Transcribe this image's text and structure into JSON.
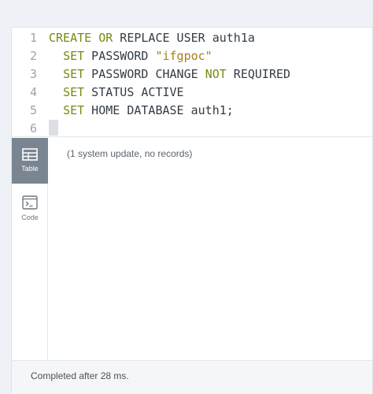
{
  "editor": {
    "lines": [
      {
        "number": "1",
        "parts": [
          {
            "text": "CREATE",
            "cls": "kw"
          },
          {
            "text": " "
          },
          {
            "text": "OR",
            "cls": "kw"
          },
          {
            "text": " REPLACE USER auth1a"
          }
        ]
      },
      {
        "number": "2",
        "parts": [
          {
            "text": "  "
          },
          {
            "text": "SET",
            "cls": "kw"
          },
          {
            "text": " PASSWORD "
          },
          {
            "text": "\"ifgpoc\"",
            "cls": "str"
          }
        ]
      },
      {
        "number": "3",
        "parts": [
          {
            "text": "  "
          },
          {
            "text": "SET",
            "cls": "kw"
          },
          {
            "text": " PASSWORD CHANGE "
          },
          {
            "text": "NOT",
            "cls": "kw"
          },
          {
            "text": " REQUIRED"
          }
        ]
      },
      {
        "number": "4",
        "parts": [
          {
            "text": "  "
          },
          {
            "text": "SET",
            "cls": "kw"
          },
          {
            "text": " STATUS ACTIVE"
          }
        ]
      },
      {
        "number": "5",
        "parts": [
          {
            "text": "  "
          },
          {
            "text": "SET",
            "cls": "kw"
          },
          {
            "text": " HOME DATABASE auth1;"
          }
        ]
      },
      {
        "number": "6",
        "parts": []
      }
    ]
  },
  "sidebar": {
    "items": [
      {
        "label": "Table",
        "icon": "table-icon",
        "active": true
      },
      {
        "label": "Code",
        "icon": "code-icon",
        "active": false
      }
    ]
  },
  "result": {
    "message": "(1 system update, no records)"
  },
  "footer": {
    "status": "Completed after 28 ms."
  },
  "colors": {
    "keyword": "#768a10",
    "string": "#a57f18",
    "active_tab": "#7a8592"
  }
}
